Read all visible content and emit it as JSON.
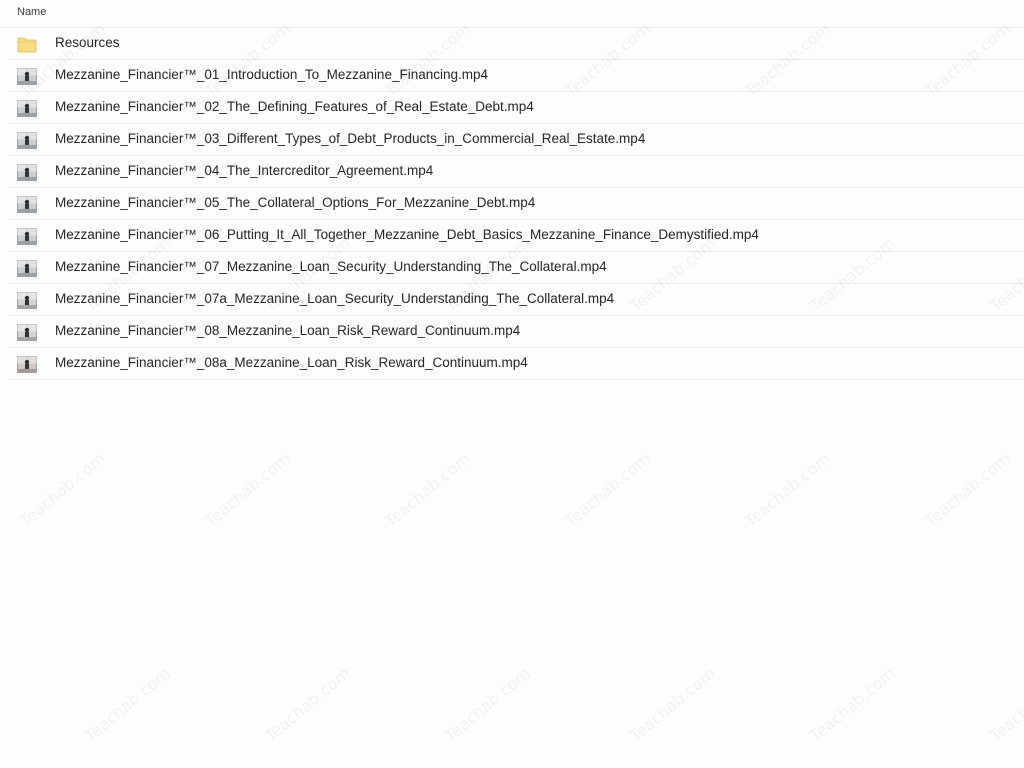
{
  "header": {
    "name_column": "Name"
  },
  "files": [
    {
      "icon": "folder-icon",
      "name": "Resources"
    },
    {
      "icon": "video-thumbnail-icon",
      "name": "Mezzanine_Financier™_01_Introduction_To_Mezzanine_Financing.mp4"
    },
    {
      "icon": "video-thumbnail-icon",
      "name": "Mezzanine_Financier™_02_The_Defining_Features_of_Real_Estate_Debt.mp4"
    },
    {
      "icon": "video-thumbnail-icon",
      "name": "Mezzanine_Financier™_03_Different_Types_of_Debt_Products_in_Commercial_Real_Estate.mp4"
    },
    {
      "icon": "video-thumbnail-icon",
      "name": "Mezzanine_Financier™_04_The_Intercreditor_Agreement.mp4"
    },
    {
      "icon": "video-thumbnail-icon",
      "name": "Mezzanine_Financier™_05_The_Collateral_Options_For_Mezzanine_Debt.mp4"
    },
    {
      "icon": "video-thumbnail-icon",
      "name": "Mezzanine_Financier™_06_Putting_It_All_Together_Mezzanine_Debt_Basics_Mezzanine_Finance_Demystified.mp4"
    },
    {
      "icon": "video-thumbnail-icon",
      "name": "Mezzanine_Financier™_07_Mezzanine_Loan_Security_Understanding_The_Collateral.mp4"
    },
    {
      "icon": "video-thumbnail-icon",
      "name": "Mezzanine_Financier™_07a_Mezzanine_Loan_Security_Understanding_The_Collateral.mp4"
    },
    {
      "icon": "video-thumbnail-icon",
      "name": "Mezzanine_Financier™_08_Mezzanine_Loan_Risk_Reward_Continuum.mp4"
    },
    {
      "icon": "video-thumbnail-icon",
      "name": "Mezzanine_Financier™_08a_Mezzanine_Loan_Risk_Reward_Continuum.mp4"
    }
  ],
  "watermark": {
    "text": "Teachab.com"
  },
  "colors": {
    "background": "#fdfdfd",
    "divider": "#ececec",
    "folder": "#f5d77a",
    "text": "#262626"
  }
}
